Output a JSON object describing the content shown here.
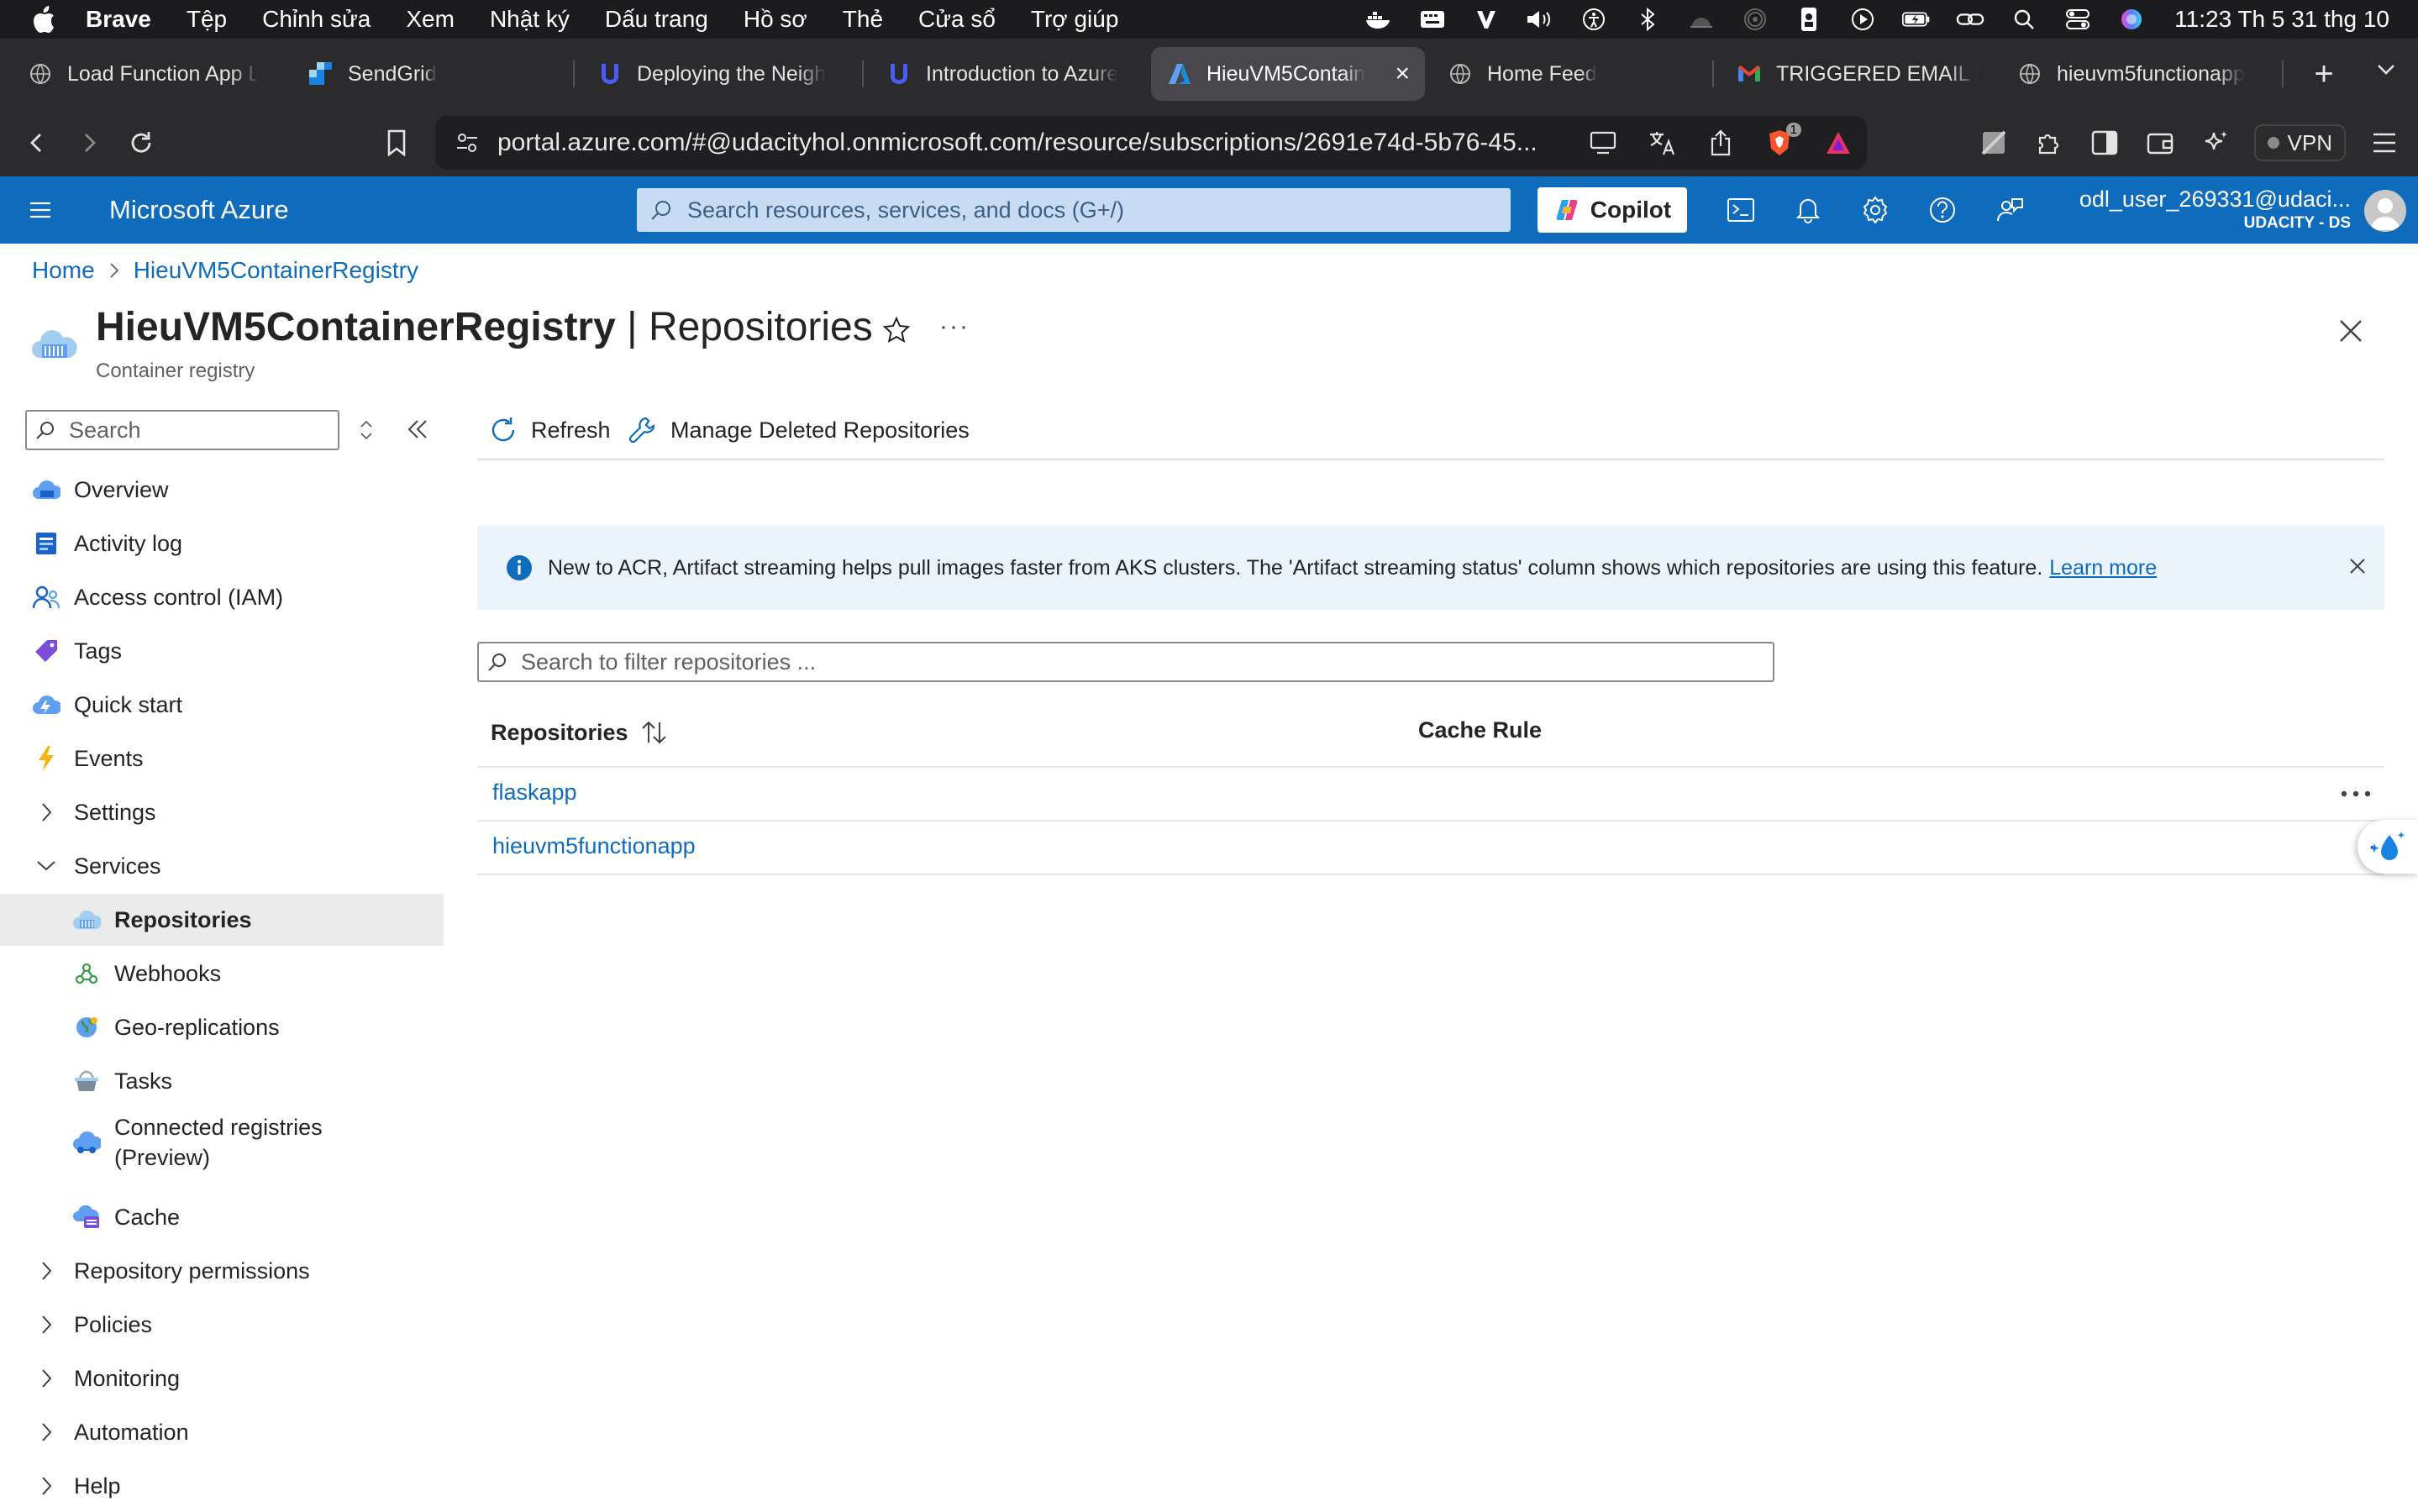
{
  "os_menubar": {
    "app_name": "Brave",
    "menus": [
      "Tệp",
      "Chỉnh sửa",
      "Xem",
      "Nhật ký",
      "Dấu trang",
      "Hồ sơ",
      "Thẻ",
      "Cửa sổ",
      "Trợ giúp"
    ],
    "clock": "11:23 Th 5 31 thg 10",
    "status_icons": [
      "docker-icon",
      "keyboard-icon",
      "v-icon",
      "volume-icon",
      "accessibility-icon",
      "bluetooth-icon",
      "brightness-icon",
      "airdrop-icon",
      "phone-icon",
      "play-icon",
      "battery-icon",
      "link-icon",
      "search-icon",
      "control-center-icon",
      "siri-icon"
    ]
  },
  "tabs": [
    {
      "label": "Load Function App L",
      "icon": "globe-icon"
    },
    {
      "label": "SendGrid",
      "icon": "sendgrid-icon"
    },
    {
      "label": "Deploying the Neigh",
      "icon": "udacity-icon"
    },
    {
      "label": "Introduction to Azure",
      "icon": "udacity-icon"
    },
    {
      "label": "HieuVM5Contain",
      "icon": "azure-icon",
      "active": true
    },
    {
      "label": "Home Feed",
      "icon": "globe-icon"
    },
    {
      "label": "TRIGGERED EMAIL F",
      "icon": "gmail-icon"
    },
    {
      "label": "hieuvm5functionapp",
      "icon": "globe-icon"
    }
  ],
  "browser": {
    "url": "portal.azure.com/#@udacityhol.onmicrosoft.com/resource/subscriptions/2691e74d-5b76-45...",
    "brave_badge": "1",
    "vpn_label": "VPN"
  },
  "azure_header": {
    "brand": "Microsoft Azure",
    "search_placeholder": "Search resources, services, and docs (G+/)",
    "copilot_label": "Copilot",
    "user_name": "odl_user_269331@udaci...",
    "tenant": "UDACITY - DS"
  },
  "breadcrumb": {
    "home": "Home",
    "current": "HieuVM5ContainerRegistry"
  },
  "page": {
    "resource_name": "HieuVM5ContainerRegistry",
    "separator": " | ",
    "blade_name": "Repositories",
    "subtitle": "Container registry",
    "more": "···"
  },
  "left_menu": {
    "search_placeholder": "Search",
    "items": [
      {
        "label": "Overview",
        "icon": "cloud-overview-icon"
      },
      {
        "label": "Activity log",
        "icon": "activity-log-icon"
      },
      {
        "label": "Access control (IAM)",
        "icon": "people-icon"
      },
      {
        "label": "Tags",
        "icon": "tag-icon"
      },
      {
        "label": "Quick start",
        "icon": "quickstart-icon"
      },
      {
        "label": "Events",
        "icon": "lightning-icon"
      },
      {
        "label": "Settings",
        "icon": "chevron-right-icon"
      },
      {
        "label": "Services",
        "icon": "chevron-down-icon"
      },
      {
        "label": "Repositories",
        "icon": "repositories-icon"
      },
      {
        "label": "Webhooks",
        "icon": "webhooks-icon"
      },
      {
        "label": "Geo-replications",
        "icon": "globe-icon"
      },
      {
        "label": "Tasks",
        "icon": "tasks-icon"
      },
      {
        "label": "Connected registries (Preview)",
        "icon": "connected-registries-icon"
      },
      {
        "label": "Cache",
        "icon": "cache-icon"
      },
      {
        "label": "Repository permissions",
        "icon": "chevron-right-icon"
      },
      {
        "label": "Policies",
        "icon": "chevron-right-icon"
      },
      {
        "label": "Monitoring",
        "icon": "chevron-right-icon"
      },
      {
        "label": "Automation",
        "icon": "chevron-right-icon"
      },
      {
        "label": "Help",
        "icon": "chevron-right-icon"
      }
    ]
  },
  "commands": {
    "refresh": "Refresh",
    "manage_deleted": "Manage Deleted Repositories"
  },
  "banner": {
    "text": "New to ACR, Artifact streaming helps pull images faster from AKS clusters. The 'Artifact streaming status' column shows which repositories are using this feature.",
    "link": "Learn more"
  },
  "filter": {
    "placeholder": "Search to filter repositories ..."
  },
  "table": {
    "columns": [
      "Repositories",
      "Cache Rule"
    ],
    "rows": [
      {
        "repository": "flaskapp",
        "cache_rule": ""
      },
      {
        "repository": "hieuvm5functionapp",
        "cache_rule": ""
      }
    ]
  },
  "colors": {
    "azure_blue": "#0f6cbd",
    "banner_bg": "#ebf3fc",
    "active_item_bg": "#ebebeb"
  }
}
